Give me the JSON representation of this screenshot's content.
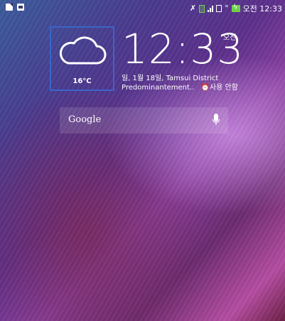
{
  "status_bar": {
    "time": "오전 12:33"
  },
  "widget": {
    "temperature": "16°C",
    "time": "12:33",
    "ampm": "오전",
    "date_location": "일, 1월 18일, Tamsui District",
    "condition": "Predominantement..",
    "alarm": "사용 안함"
  },
  "search": {
    "label": "Google"
  }
}
